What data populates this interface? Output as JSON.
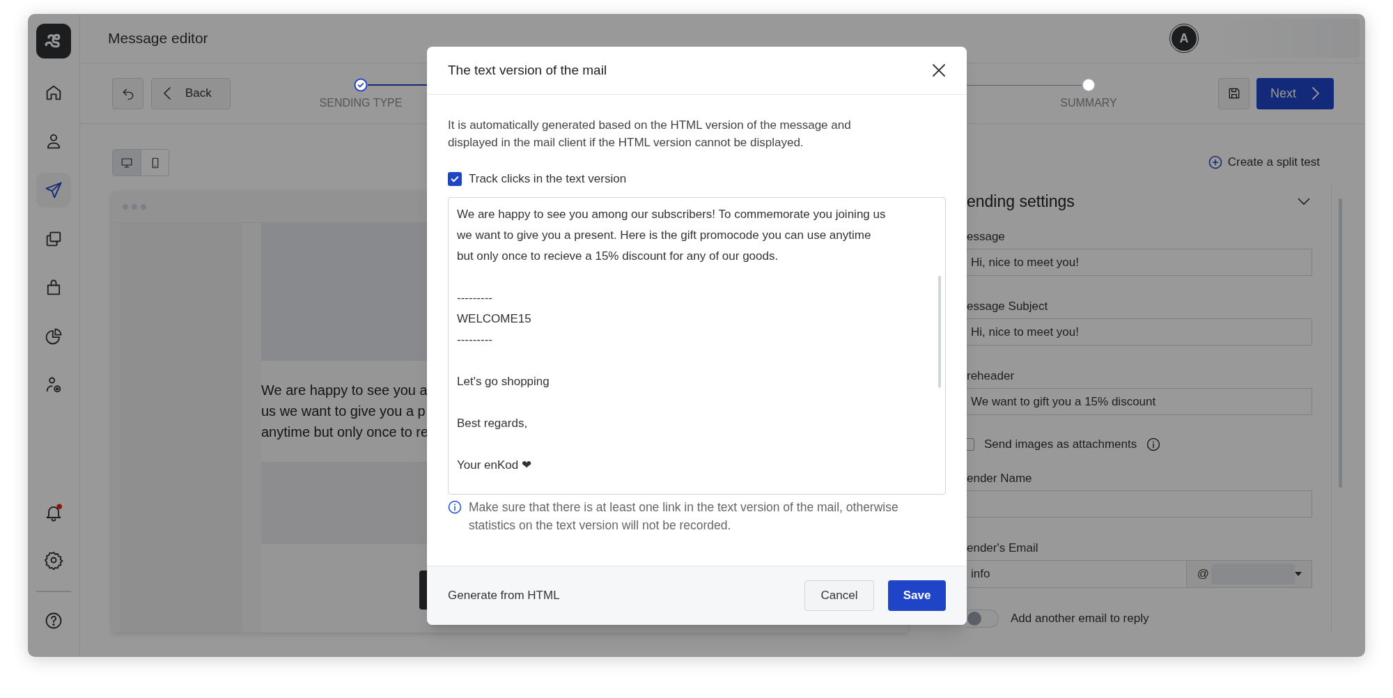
{
  "sidebar": {
    "items": [
      {
        "kind": "home",
        "selected": false
      },
      {
        "kind": "contacts",
        "selected": false
      },
      {
        "kind": "campaigns",
        "selected": true
      },
      {
        "kind": "templates",
        "selected": false
      },
      {
        "kind": "shop",
        "selected": false
      },
      {
        "kind": "analytics",
        "selected": false
      },
      {
        "kind": "admin",
        "selected": false
      }
    ],
    "bottom_items": [
      {
        "kind": "notifications",
        "unread": true
      },
      {
        "kind": "settings",
        "unread": false
      },
      {
        "kind": "help",
        "unread": false
      }
    ]
  },
  "header": {
    "title": "Message editor",
    "avatar": "A"
  },
  "toolbar": {
    "back": "Back",
    "next": "Next",
    "steps": [
      {
        "label": "SENDING TYPE",
        "done": true
      },
      {
        "label": "SUMMARY",
        "done": false
      }
    ]
  },
  "preview": {
    "device_modes": [
      {
        "kind": "desktop",
        "selected": true
      },
      {
        "kind": "mobile",
        "selected": false
      }
    ],
    "lines": [
      "We are happy to see you a",
      "us we want to give you a p",
      "anytime but only once to re"
    ]
  },
  "split_test": "Create a split test",
  "settings": {
    "title": "ending settings",
    "fields": [
      {
        "label": "essage",
        "value": "Hi, nice to meet you!"
      },
      {
        "label": "essage Subject",
        "value": "Hi, nice to meet you!"
      },
      {
        "label": "reheader",
        "value": "We want to gift you a 15% discount"
      }
    ],
    "send_images": {
      "label": "Send images as attachments",
      "checked": false
    },
    "sender_name": {
      "label": "ender Name"
    },
    "sender_email": {
      "label": "ender's Email",
      "value": "info",
      "domain_prefix": "@"
    },
    "reply_toggle": {
      "label": "Add another email to reply",
      "on": false
    }
  },
  "modal": {
    "title": "The text version of the mail",
    "description": "It is automatically generated based on the HTML version of the message and displayed in the mail client if the HTML version cannot be displayed.",
    "track_clicks": {
      "label": "Track clicks in the text version",
      "checked": true
    },
    "text_paragraphs": [
      [
        "We are happy to see you among our subscribers! To commemorate you joining us",
        "we want to give you a present. Here is the gift promocode you can use anytime",
        "but only once to recieve a 15% discount for any of our goods."
      ],
      [
        "---------",
        "WELCOME15",
        "---------"
      ],
      [
        "Let's go shopping"
      ],
      [
        "Best regards,"
      ],
      [
        "Your enKod ❤"
      ]
    ],
    "note": "Make sure that there is at least one link in the text version of the mail, otherwise statistics on the text version will not be recorded.",
    "generate": "Generate from HTML",
    "cancel": "Cancel",
    "save": "Save"
  }
}
